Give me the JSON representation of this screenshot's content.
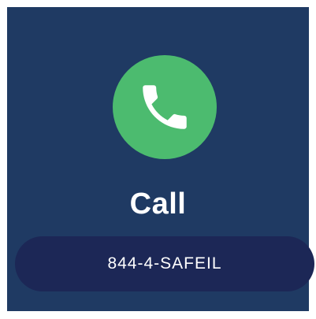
{
  "card": {
    "background": "#1f3a63",
    "icon": {
      "name": "phone-icon",
      "circle_color": "#4cbb6f",
      "glyph_color": "#ffffff"
    },
    "title": "Call",
    "number_button": {
      "label": "844-4-SAFEIL",
      "background": "#1c2756"
    }
  }
}
